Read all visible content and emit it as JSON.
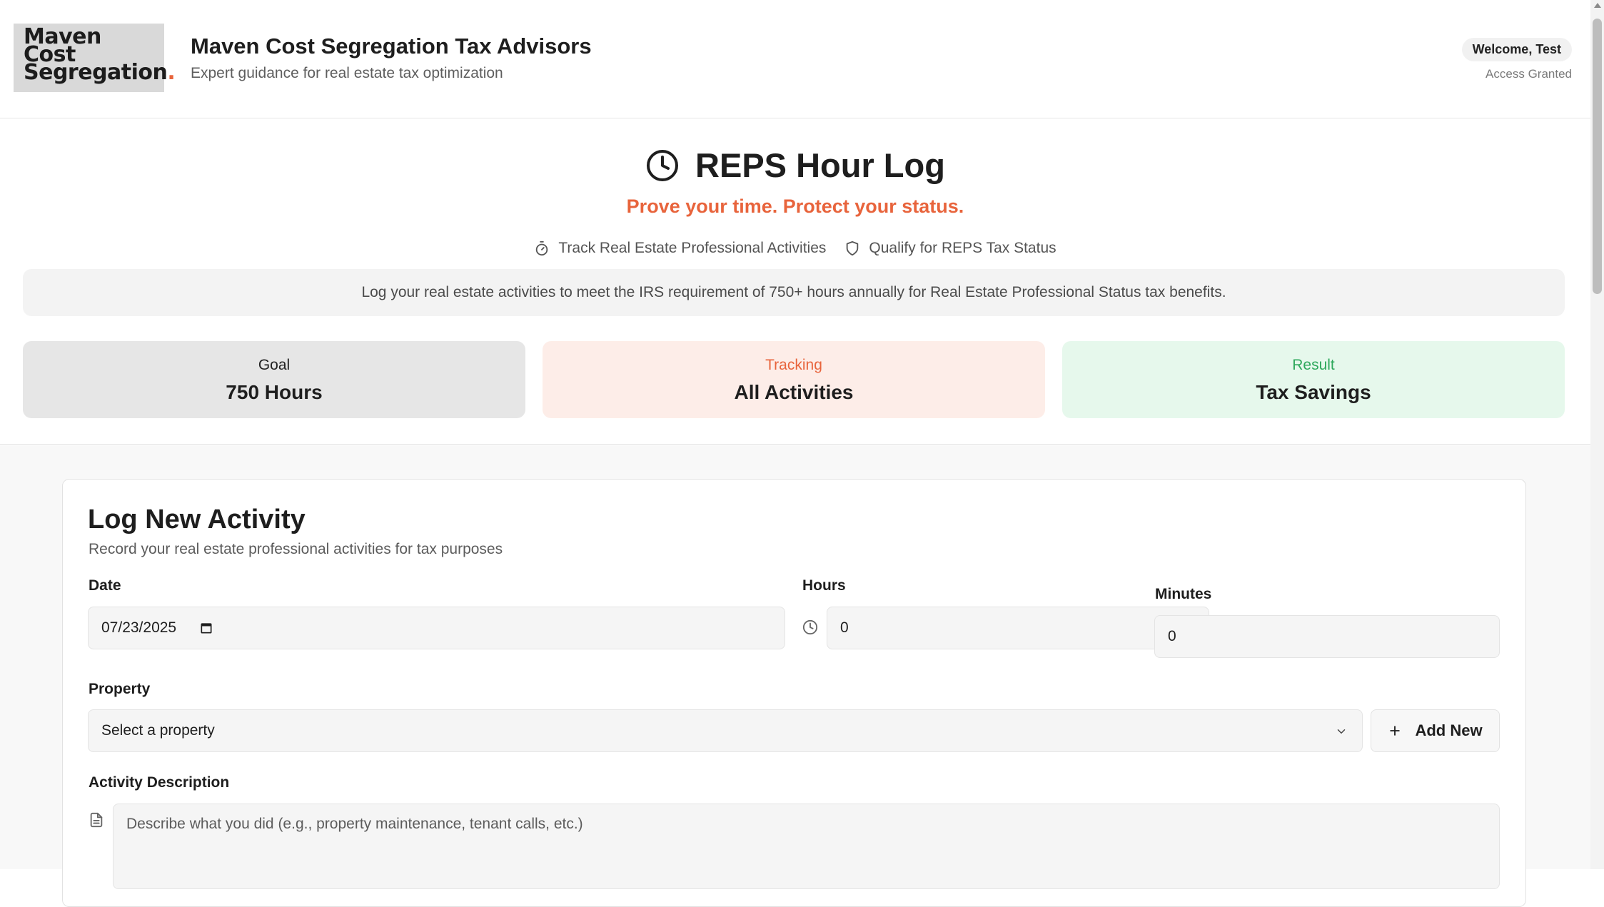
{
  "header": {
    "logo_lines": [
      "Maven",
      "Cost",
      "Segregation"
    ],
    "logo_dot": ".",
    "title": "Maven Cost Segregation Tax Advisors",
    "subtitle": "Expert guidance for real estate tax optimization",
    "welcome": "Welcome, Test",
    "access": "Access Granted"
  },
  "hero": {
    "title": "REPS Hour Log",
    "tagline": "Prove your time. Protect your status.",
    "features": [
      {
        "icon": "stopwatch-icon",
        "label": "Track Real Estate Professional Activities"
      },
      {
        "icon": "shield-icon",
        "label": "Qualify for REPS Tax Status"
      }
    ],
    "info": "Log your real estate activities to meet the IRS requirement of 750+ hours annually for Real Estate Professional Status tax benefits."
  },
  "stats": [
    {
      "label": "Goal",
      "value": "750 Hours"
    },
    {
      "label": "Tracking",
      "value": "All Activities"
    },
    {
      "label": "Result",
      "value": "Tax Savings"
    }
  ],
  "form": {
    "title": "Log New Activity",
    "subtitle": "Record your real estate professional activities for tax purposes",
    "date_label": "Date",
    "date_value": "07/23/2025",
    "hours_label": "Hours",
    "hours_value": "0",
    "minutes_label": "Minutes",
    "minutes_value": "0",
    "property_label": "Property",
    "property_placeholder": "Select a property",
    "add_new_label": "Add New",
    "activity_label": "Activity Description",
    "activity_placeholder": "Describe what you did (e.g., property maintenance, tenant calls, etc.)"
  },
  "colors": {
    "accent": "#e8643c",
    "success": "#2ea85c",
    "goal_bg": "#e6e6e6",
    "tracking_bg": "#fdede8",
    "result_bg": "#e6f8ec"
  }
}
